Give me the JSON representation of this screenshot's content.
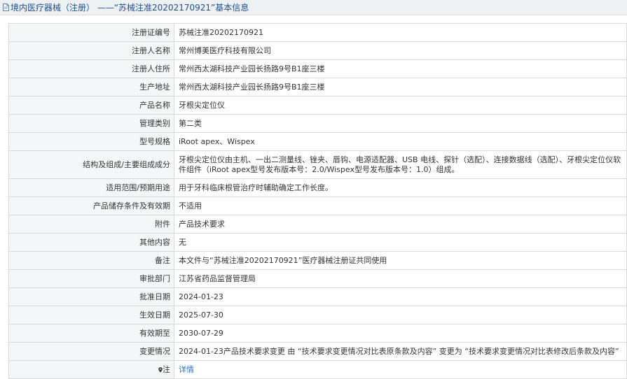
{
  "header": {
    "title": "境内医疗器械（注册） ——“苏械注准20202170921”基本信息",
    "icon": "document-icon"
  },
  "rows": [
    {
      "label": "注册证编号",
      "value": "苏械注准20202170921"
    },
    {
      "label": "注册人名称",
      "value": "常州博美医疗科技有限公司"
    },
    {
      "label": "注册人住所",
      "value": "常州西太湖科技产业园长扬路9号B1座三楼"
    },
    {
      "label": "生产地址",
      "value": "常州西太湖科技产业园长扬路9号B1座三楼"
    },
    {
      "label": "产品名称",
      "value": "牙根尖定位仪"
    },
    {
      "label": "管理类别",
      "value": "第二类"
    },
    {
      "label": "型号规格",
      "value": "iRoot apex、Wispex"
    },
    {
      "label": "结构及组成/主要组成成分",
      "value": "牙根尖定位仪由主机、一出二测量线、锉夹、唇钩、电源适配器、USB 电线、探针（选配）、连接数据线（选配）、牙根尖定位仪软件组件（iRoot apex型号发布版本号：2.0/Wispex型号发布版本号：1.0）组成。"
    },
    {
      "label": "适用范围/预期用途",
      "value": "用于牙科临床根管治疗时辅助确定工作长度。"
    },
    {
      "label": "产品储存条件及有效期",
      "value": "不适用"
    },
    {
      "label": "附件",
      "value": "产品技术要求"
    },
    {
      "label": "其他内容",
      "value": "无"
    },
    {
      "label": "备注",
      "value": "本文件与“苏械注准20202170921”医疗器械注册证共同使用"
    },
    {
      "label": "审批部门",
      "value": "江苏省药品监督管理局"
    },
    {
      "label": "批准日期",
      "value": "2024-01-23"
    },
    {
      "label": "生效日期",
      "value": "2025-07-30"
    },
    {
      "label": "有效期至",
      "value": "2030-07-29"
    },
    {
      "label": "变更情况",
      "value": "2024-01-23产品技术要求变更 由 “技术要求变更情况对比表原条款及内容” 变更为 “技术要求变更情况对比表修改后条款及内容”"
    }
  ],
  "note_row": {
    "label": "注",
    "label_icon": "location-pin-icon",
    "link_text": "详情"
  },
  "colors": {
    "title_text": "#1f4e8c",
    "label_bg": "#f5f6f8",
    "border": "#d9d9d9",
    "link": "#2f6fc4"
  }
}
